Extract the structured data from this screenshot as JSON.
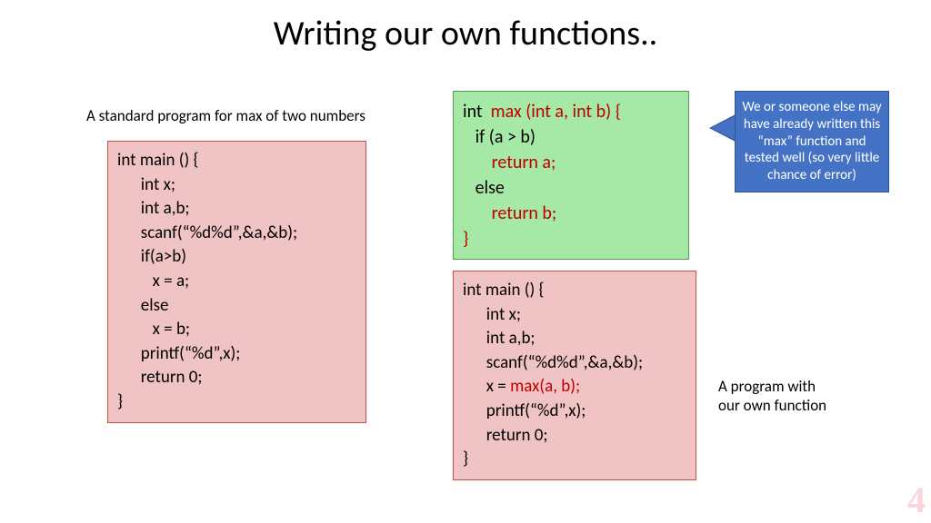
{
  "title": "Writing our own functions..",
  "caption_left": "A standard program for max of two numbers",
  "caption_right": "A program with\nour own function",
  "callout_text": "We or someone else may have already written this “max” function and tested well (so very little chance of error)",
  "code_left": "int main () {\n      int x;\n      int a,b;\n      scanf(“%d%d”,&a,&b);\n      if(a>b)\n         x = a;\n      else\n         x = b;\n      printf(“%d”,x);\n      return 0;\n}",
  "code_green_prefix": "int  ",
  "code_green_sig": "max (int a, int b) {",
  "code_green_l2": "   if (a > b)",
  "code_green_ret_a": "       return a;",
  "code_green_l4": "   else",
  "code_green_ret_b": "       return b;",
  "code_green_close": "}",
  "code_right_l1": "int main () {",
  "code_right_l2": "      int x;",
  "code_right_l3": "      int a,b;",
  "code_right_l4": "      scanf(“%d%d”,&a,&b);",
  "code_right_l5_pre": "      x = ",
  "code_right_l5_red": "max(a, b);",
  "code_right_l6": "      printf(“%d”,x);",
  "code_right_l7": "      return 0;",
  "code_right_l8": "}",
  "watermark": "4"
}
